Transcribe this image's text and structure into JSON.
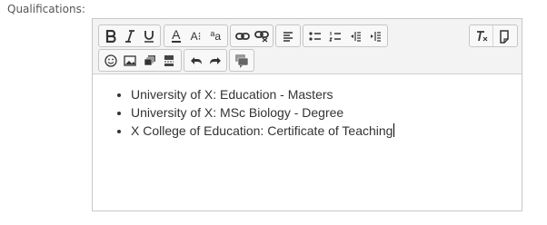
{
  "field": {
    "label": "Qualifications:"
  },
  "toolbar": {
    "text_color_glyph": "A",
    "font_size_glyph": "A",
    "format_glyph": "a"
  },
  "editor": {
    "items": [
      "University of X: Education - Masters",
      "University of X: MSc Biology - Degree",
      "X College of Education: Certificate of Teaching"
    ]
  },
  "colors": {
    "border": "#c8c8c8",
    "toolbar_bg": "#f3f3f3",
    "icon": "#333333"
  }
}
